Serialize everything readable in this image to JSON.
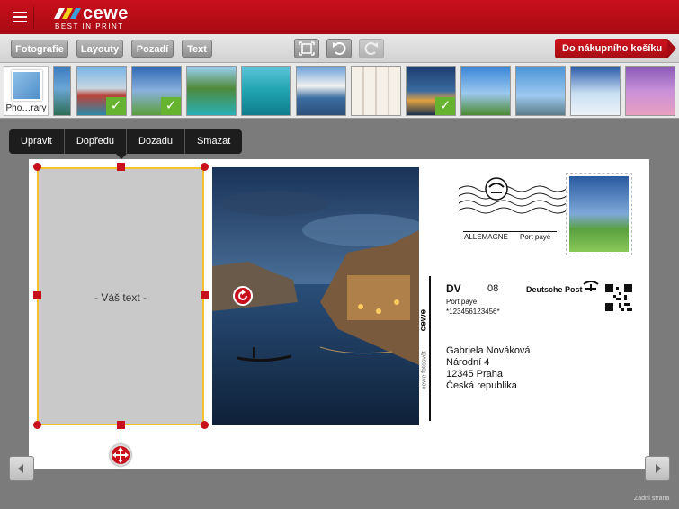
{
  "brand": {
    "name": "cewe",
    "tagline": "BEST IN PRINT"
  },
  "toolbar": {
    "tabs": [
      "Fotografie",
      "Layouty",
      "Pozadí",
      "Text"
    ],
    "cart_label": "Do nákupního košíku"
  },
  "library": {
    "label": "Pho…rary"
  },
  "context_menu": [
    "Upravit",
    "Dopředu",
    "Dozadu",
    "Smazat"
  ],
  "card": {
    "text_placeholder": "- Váš text -",
    "postmark": {
      "country": "ALLEMAGNE",
      "fee": "Port payé"
    },
    "dv": {
      "code": "DV",
      "num": "08",
      "fee": "Port payé",
      "id": "*123456123456*"
    },
    "carrier": "Deutsche Post",
    "address": [
      "Gabriela Nováková",
      "Národní 4",
      "12345 Praha",
      "Česká republika"
    ],
    "vertical_brand": "cewe",
    "vertical_credit": "cewe fotosvět"
  },
  "footer": {
    "backside_label": "Zadní strana"
  },
  "colors": {
    "brand_red": "#c8101c",
    "check_green": "#65b32e",
    "selection_yellow": "#f5c22a"
  }
}
